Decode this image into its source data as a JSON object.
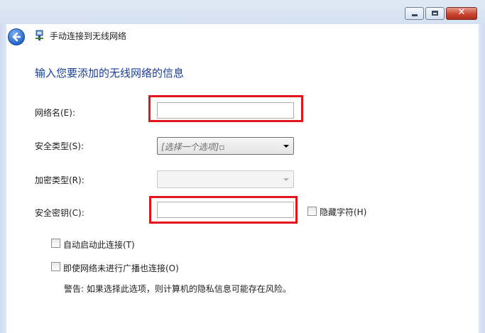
{
  "window": {
    "controls": {
      "minimize": "minimize-icon",
      "maximize": "maximize-icon",
      "close": "✕"
    }
  },
  "header": {
    "back_icon": "back-arrow-icon",
    "network_icon": "network-icon",
    "title": "手动连接到无线网络"
  },
  "form": {
    "heading": "输入您要添加的无线网络的信息",
    "network_name_label": "网络名(E):",
    "network_name_value": "",
    "security_type_label": "安全类型(S):",
    "security_type_selected": "[选择一个选项]▫",
    "encryption_type_label": "加密类型(R):",
    "encryption_type_selected": "",
    "security_key_label": "安全密钥(C):",
    "security_key_value": "",
    "hide_chars_label": "隐藏字符(H)",
    "hide_chars_checked": false,
    "auto_start_label": "自动启动此连接(T)",
    "auto_start_checked": false,
    "connect_hidden_label": "即使网络未进行广播也连接(O)",
    "connect_hidden_checked": false,
    "warning": "警告: 如果选择此选项，则计算机的隐私信息可能存在风险。"
  },
  "colors": {
    "highlight": "#e4141b",
    "heading": "#1a3e9a"
  }
}
